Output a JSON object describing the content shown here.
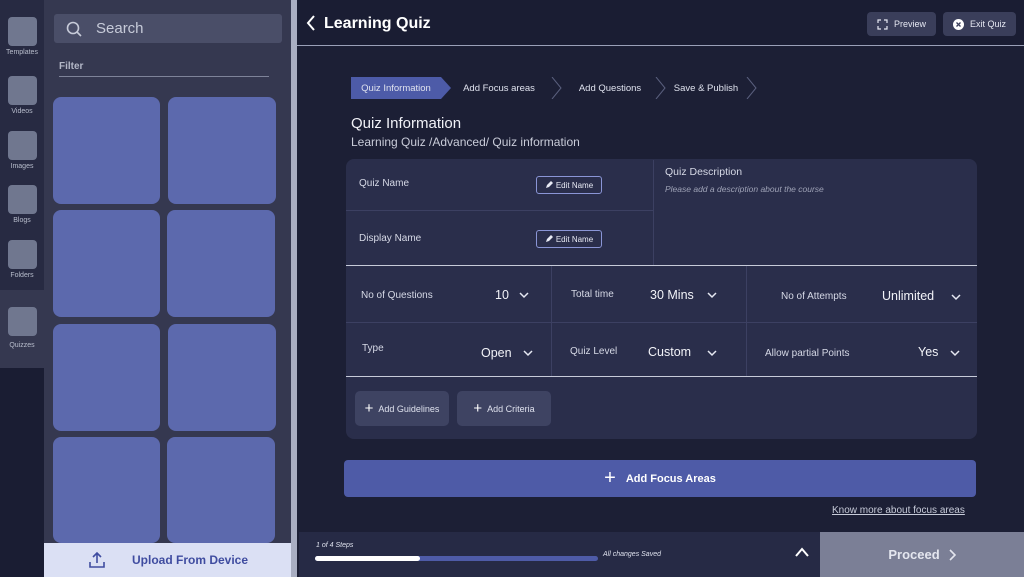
{
  "sidebar": {
    "items": [
      {
        "label": "Templates",
        "icon": "templates-icon"
      },
      {
        "label": "Videos",
        "icon": "videos-icon"
      },
      {
        "label": "Images",
        "icon": "images-icon"
      },
      {
        "label": "Blogs",
        "icon": "blogs-icon"
      },
      {
        "label": "Folders",
        "icon": "folders-icon"
      },
      {
        "label": "Quizzes",
        "icon": "quizzes-icon"
      }
    ],
    "active": "Quizzes"
  },
  "assets": {
    "search_placeholder": "Search",
    "filter_label": "Filter",
    "upload_label": "Upload From Device"
  },
  "header": {
    "back_icon": "chevron-left-icon",
    "title": "Learning Quiz",
    "preview_label": "Preview",
    "exit_label": "Exit Quiz"
  },
  "stepper": {
    "steps": [
      "Quiz Information",
      "Add Focus areas",
      "Add Questions",
      "Save & Publish"
    ],
    "active": "Quiz Information"
  },
  "section": {
    "title": "Quiz Information",
    "breadcrumb": "Learning Quiz /Advanced/ Quiz information"
  },
  "form": {
    "quiz_name_label": "Quiz Name",
    "display_name_label": "Display Name",
    "edit_name_label": "Edit Name",
    "description_label": "Quiz Description",
    "description_placeholder": "Please add a description about the course",
    "questions_label": "No of Questions",
    "questions_value": "10",
    "total_time_label": "Total time",
    "total_time_value": "30 Mins",
    "attempts_label": "No of Attempts",
    "attempts_value": "Unlimited",
    "type_label": "Type",
    "type_value": "Open",
    "level_label": "Quiz Level",
    "level_value": "Custom",
    "partial_label": "Allow partial Points",
    "partial_value": "Yes",
    "add_guidelines_label": "Add Guidelines",
    "add_criteria_label": "Add Criteria"
  },
  "focus": {
    "add_label": "Add Focus Areas",
    "know_more": "Know more about focus areas"
  },
  "footer": {
    "steps_text": "1 of 4 Steps",
    "progress": 0.25,
    "saved_text": "All changes Saved",
    "proceed_label": "Proceed"
  },
  "colors": {
    "accent": "#4e5ba7",
    "tile": "#5c69ad",
    "background": "#1c1f35"
  }
}
